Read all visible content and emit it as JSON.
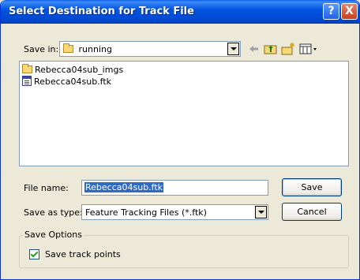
{
  "window": {
    "title": "Select Destination for Track File"
  },
  "title_buttons": {
    "help": "?",
    "close": "X"
  },
  "save_in": {
    "label": "Save in:",
    "value": "running"
  },
  "toolbar": {
    "icons": [
      "back-arrow-icon",
      "up-one-level-icon",
      "create-new-folder-icon",
      "view-menu-icon"
    ]
  },
  "file_list": {
    "items": [
      {
        "name": "Rebecca04sub_imgs",
        "icon": "folder-icon"
      },
      {
        "name": "Rebecca04sub.ftk",
        "icon": "ftk-file-icon"
      }
    ]
  },
  "file_name": {
    "label": "File name:",
    "value": "Rebecca04sub.ftk"
  },
  "save_as_type": {
    "label": "Save as type:",
    "value": "Feature Tracking Files (*.ftk)"
  },
  "buttons": {
    "save": "Save",
    "cancel": "Cancel"
  },
  "save_options": {
    "title": "Save Options",
    "save_track_points": {
      "label": "Save track points",
      "checked": true
    }
  }
}
